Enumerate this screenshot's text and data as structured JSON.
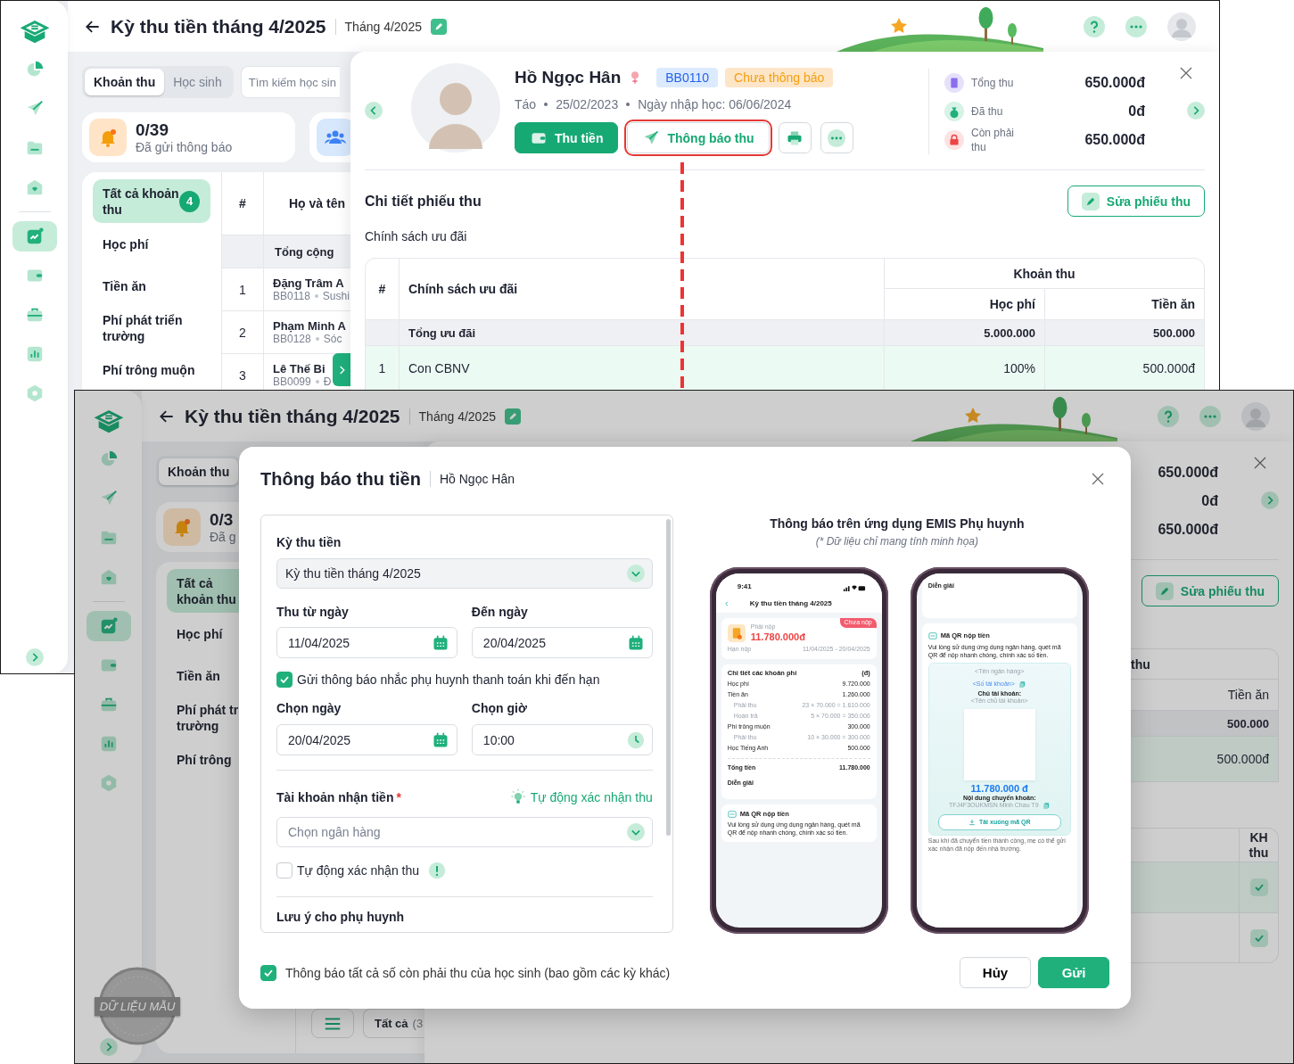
{
  "screenshots": [
    {
      "sidebar": {
        "items": [
          {
            "selected": false
          },
          {
            "selected": false
          },
          {
            "selected": false
          },
          {
            "selected": false
          },
          {
            "selected": true
          },
          {
            "selected": false
          },
          {
            "selected": false
          },
          {
            "selected": false
          },
          {
            "selected": false
          }
        ]
      },
      "header": {
        "title": "Kỳ thu tiền tháng 4/2025",
        "period": "Tháng 4/2025"
      },
      "tabs": [
        {
          "label": "Khoản thu",
          "selected": true
        },
        {
          "label": "Học sinh",
          "selected": false
        }
      ],
      "search": {
        "placeholder": "Tìm kiếm học sin"
      },
      "stats": [
        {
          "kind": "bell",
          "value": "0/39",
          "label": "Đã gửi thông báo"
        },
        {
          "kind": "people"
        }
      ],
      "categories": [
        {
          "label": "Tất cả khoản thu",
          "count": "4",
          "selected": true
        },
        {
          "label": "Học phí",
          "selected": false
        },
        {
          "label": "Tiền ăn",
          "selected": false
        },
        {
          "label": "Phí phát triển trường",
          "selected": false
        },
        {
          "label": "Phí trông muộn",
          "selected": false
        }
      ],
      "table": {
        "columns": [
          "#",
          "Họ và tên"
        ],
        "total_label": "Tổng cộng",
        "rows": [
          {
            "index": "1",
            "name": "Đặng Trâm A",
            "code": "BB0118",
            "group": "Sushi"
          },
          {
            "index": "2",
            "name": "Phạm Minh A",
            "code": "BB0128",
            "group": "Sóc"
          },
          {
            "index": "3",
            "name": "Lê Thế Bi",
            "code": "BB0099",
            "group": "Đ"
          }
        ]
      },
      "drawer": {
        "student": {
          "name": "Hồ Ngọc Hân",
          "code": "BB0110",
          "status": "Chưa thông báo",
          "meta": [
            "Táo",
            "25/02/2023",
            "Ngày nhập học: 06/06/2024"
          ]
        },
        "actions": [
          {
            "kind": "collect",
            "label": "Thu tiền",
            "highlighted": false
          },
          {
            "kind": "notify",
            "label": "Thông báo thu",
            "highlighted": true
          },
          {
            "kind": "print",
            "highlighted": false
          },
          {
            "kind": "more",
            "highlighted": false
          }
        ],
        "summary": [
          {
            "kind": "total",
            "label": "Tổng thu",
            "value": "650.000đ"
          },
          {
            "kind": "paid",
            "label": "Đã thu",
            "value": "0đ"
          },
          {
            "kind": "due",
            "label": "Còn phải thu",
            "value": "650.000đ"
          }
        ],
        "section_title": "Chi tiết phiếu thu",
        "edit_button": "Sửa phiếu thu",
        "policy_title": "Chính sách ưu đãi",
        "policy_table": {
          "columns": [
            "#",
            "Chính sách ưu đãi"
          ],
          "group": "Khoản thu",
          "subcolumns": [
            "Học phí",
            "Tiền ăn"
          ],
          "total": {
            "label": "Tổng ưu đãi",
            "values": [
              "5.000.000",
              "500.000"
            ]
          },
          "rows": [
            {
              "index": "1",
              "name": "Con CBNV",
              "values": [
                "100%",
                "500.000đ"
              ]
            }
          ]
        }
      }
    },
    {
      "sidebar": {
        "items": [
          {
            "selected": false
          },
          {
            "selected": false
          },
          {
            "selected": false
          },
          {
            "selected": false
          },
          {
            "selected": true
          },
          {
            "selected": false
          },
          {
            "selected": false
          },
          {
            "selected": false
          },
          {
            "selected": false
          }
        ]
      },
      "header": {
        "title": "Kỳ thu tiền tháng 4/2025",
        "period": "Tháng 4/2025"
      },
      "tabs": [
        {
          "label": "Khoản thu",
          "selected": true
        }
      ],
      "stats": [
        {
          "kind": "bell",
          "value": "0/3",
          "label": "Đã g"
        }
      ],
      "categories": [
        {
          "label": "Tất cả khoản thu",
          "selected": true
        },
        {
          "label": "Học phí",
          "selected": false
        },
        {
          "label": "Tiền ăn",
          "selected": false
        },
        {
          "label": "Phí phát tr\ntrường",
          "selected": false
        },
        {
          "label": "Phí trông",
          "selected": false
        }
      ],
      "list_footer": {
        "filter_label": "Tất cả",
        "filter_count": "(3"
      },
      "stamp": "DỮ LIỆU MẪU",
      "drawer": {
        "summary": [
          {
            "value": "650.000đ"
          },
          {
            "value": "0đ"
          },
          {
            "value": "650.000đ"
          }
        ],
        "edit_button": "Sửa phiếu thu",
        "policy_table": {
          "group": "thu",
          "subcolumns": [
            "Tiền ăn"
          ],
          "total": {
            "values": [
              "500.000"
            ]
          },
          "rows": [
            {
              "values": [
                "500.000đ"
              ]
            }
          ]
        },
        "student_table": {
          "columns": [
            "KH thu"
          ],
          "rows": [
            {
              "checked": true
            },
            {
              "checked": true
            }
          ]
        }
      },
      "modal": {
        "title": "Thông báo thu tiền",
        "subtitle": "Hồ Ngọc Hân",
        "form": {
          "period": {
            "label": "Kỳ thu tiền",
            "value": "Kỳ thu tiền tháng 4/2025"
          },
          "from": {
            "label": "Thu từ ngày",
            "value": "11/04/2025"
          },
          "to": {
            "label": "Đến ngày",
            "value": "20/04/2025"
          },
          "reminder": {
            "label": "Gửi thông báo nhắc phụ huynh thanh toán khi đến hạn",
            "checked": true
          },
          "remind_date": {
            "label": "Chọn ngày",
            "value": "20/04/2025"
          },
          "remind_time": {
            "label": "Chọn giờ",
            "value": "10:00"
          },
          "account": {
            "label": "Tài khoản nhận tiền",
            "required_mark": "*",
            "link": "Tự động xác nhận thu",
            "placeholder": "Chọn ngân hàng"
          },
          "auto_confirm": {
            "label": "Tự động xác nhận thu",
            "checked": false
          },
          "note_label": "Lưu ý cho phụ huynh"
        },
        "preview": {
          "title": "Thông báo trên ứng dụng EMIS Phụ huynh",
          "note": "(* Dữ liệu chỉ mang tính minh họa)",
          "phones": [
            {
              "kind": "summary",
              "time": "9:41",
              "title": "Kỳ thu tiền tháng 4/2025",
              "status": "Chưa nộp",
              "due_label": "Phải nộp",
              "amount": "11.780.000đ",
              "deadline_label": "Hạn nộp",
              "deadline": "11/04/2025 - 20/04/2025",
              "details_title": "Chi tiết các khoản phí",
              "unit": "(đ)",
              "fees": [
                {
                  "kind": "main",
                  "label": "Học phí",
                  "value": "9.720.000"
                },
                {
                  "kind": "main",
                  "label": "Tiền ăn",
                  "value": "1.260.000"
                },
                {
                  "kind": "sub",
                  "label": "Phải thu",
                  "value": "23 × 70.000 = 1.610.000"
                },
                {
                  "kind": "sub",
                  "label": "Hoàn trả",
                  "value": "5 × 70.000 = 350.000"
                },
                {
                  "kind": "main",
                  "label": "Phí trông muộn",
                  "value": "300.000"
                },
                {
                  "kind": "sub",
                  "label": "Phải thu",
                  "value": "10 × 30.000 = 300.000"
                },
                {
                  "kind": "main",
                  "label": "Học Tiếng Anh",
                  "value": "500.000"
                }
              ],
              "total_label": "Tổng tiền",
              "total": "11.780.000",
              "remark_label": "Diễn giải",
              "qr_title": "Mã QR nộp tiền",
              "qr_text": "Vui lòng sử dụng ứng dụng ngân hàng, quét mã QR để nộp nhanh chóng, chính xác số tiền."
            },
            {
              "kind": "qr",
              "remark_label": "Diễn giải",
              "qr_title": "Mã QR nộp tiền",
              "qr_text": "Vui lòng sử dụng ứng dụng ngân hàng, quét mã QR để nộp nhanh chóng, chính xác số tiền.",
              "bank": "<Tên ngân hàng>",
              "account_no": "<Số tài khoản>",
              "owner_label": "Chủ tài khoản:",
              "owner": "<Tên chủ tài khoản>",
              "amount": "11.780.000 đ",
              "content_label": "Nội dung chuyển khoản:",
              "content": "TFJ4F3OUKMSN Minh Chau T9",
              "download": "Tải xuống mã QR",
              "footer": "Sau khi đã chuyển tiền thành công, mẹ có thể gửi xác nhận đã nộp đến nhà trường."
            }
          ]
        },
        "notify_all": {
          "label": "Thông báo tất cả số còn phải thu của học sinh (bao gồm các kỳ khác)",
          "checked": true
        },
        "buttons": [
          {
            "kind": "cancel",
            "label": "Hủy"
          },
          {
            "kind": "send",
            "label": "Gửi"
          }
        ]
      }
    }
  ]
}
